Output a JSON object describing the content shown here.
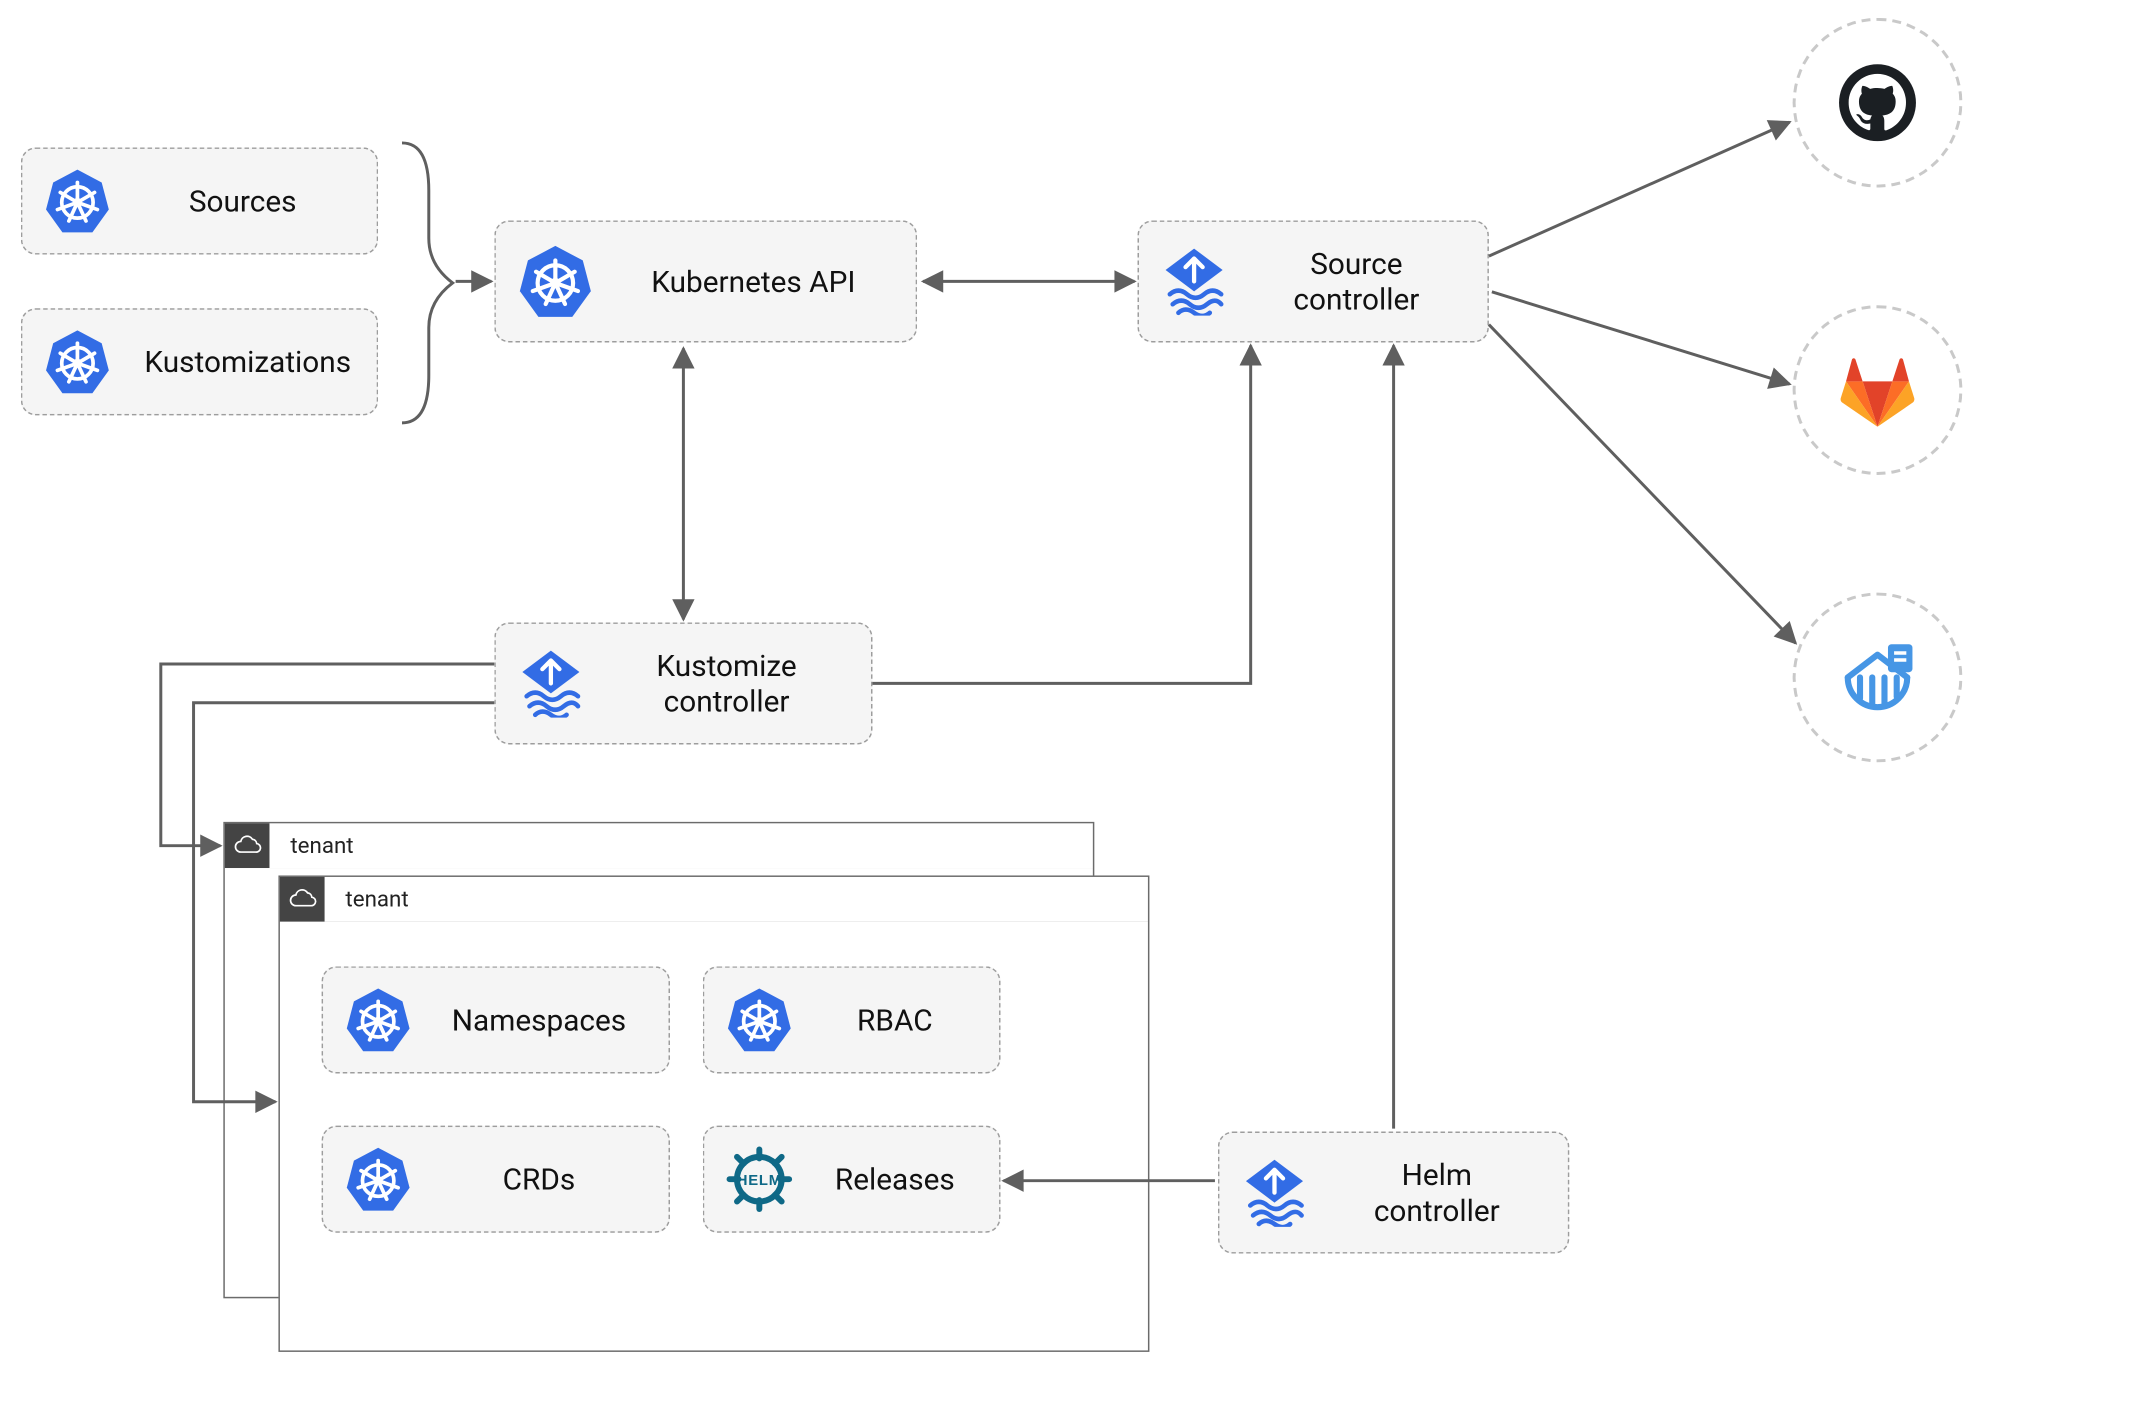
{
  "nodes": {
    "sources": "Sources",
    "kustomizations": "Kustomizations",
    "kubeapi": "Kubernetes API",
    "source_controller": "Source\ncontroller",
    "kustomize_controller": "Kustomize\ncontroller",
    "helm_controller": "Helm\ncontroller",
    "namespaces": "Namespaces",
    "rbac": "RBAC",
    "crds": "CRDs",
    "releases": "Releases"
  },
  "tenant_label": "tenant",
  "externals": {
    "github": "github-icon",
    "gitlab": "gitlab-icon",
    "harbor": "harbor-icon"
  },
  "edges_description": [
    "Sources + Kustomizations grouped (brace) -> Kubernetes API",
    "Kubernetes API <-> Source controller (bidirectional)",
    "Kubernetes API <-> Kustomize controller (bidirectional, vertical)",
    "Kustomize controller -> tenant box 1 (elbow left-down)",
    "Kustomize controller -> tenant box 2 (elbow left-down)",
    "Kustomize controller -> Source controller (elbow right-up)",
    "Helm controller -> Releases",
    "Helm controller -> Source controller (vertical up)",
    "Source controller -> github (arrow)",
    "Source controller -> gitlab (arrow)",
    "Source controller -> harbor (arrow)"
  ],
  "colors": {
    "node_fill": "#f5f5f5",
    "node_border": "#9d9d9d",
    "arrow": "#5f5f5f",
    "k8s_blue": "#326CE5",
    "flux_blue": "#326CE5",
    "helm_teal": "#0F6987",
    "github_dark": "#1B1F23",
    "gitlab_orange": "#FC6D26",
    "gitlab_red": "#E24329",
    "gitlab_yellow": "#FCA326",
    "harbor_blue": "#4696E5"
  }
}
